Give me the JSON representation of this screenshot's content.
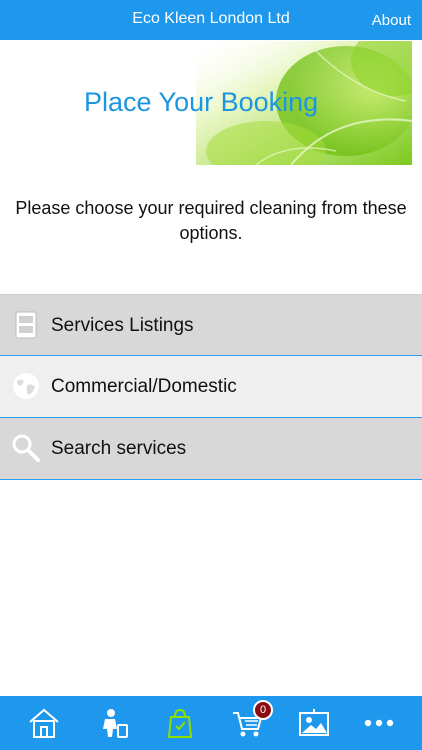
{
  "header": {
    "title": "Eco Kleen London Ltd",
    "about_label": "About"
  },
  "banner": {
    "title": "Place Your Booking"
  },
  "intro": {
    "text": "Please choose your required cleaning from these options."
  },
  "menu": {
    "items": [
      {
        "label": "Services Listings",
        "icon": "list-icon"
      },
      {
        "label": "Commercial/Domestic",
        "icon": "globe-icon"
      },
      {
        "label": "Search services",
        "icon": "search-icon"
      }
    ]
  },
  "tabbar": {
    "tabs": [
      {
        "icon": "home-icon"
      },
      {
        "icon": "cleaner-icon"
      },
      {
        "icon": "shopping-bag-icon"
      },
      {
        "icon": "cart-icon"
      },
      {
        "icon": "gallery-icon"
      },
      {
        "icon": "more-icon"
      }
    ],
    "cart_count": "0"
  },
  "colors": {
    "accent": "#1e98ec",
    "badge": "#8b0d12",
    "active_tab": "#8be000"
  }
}
